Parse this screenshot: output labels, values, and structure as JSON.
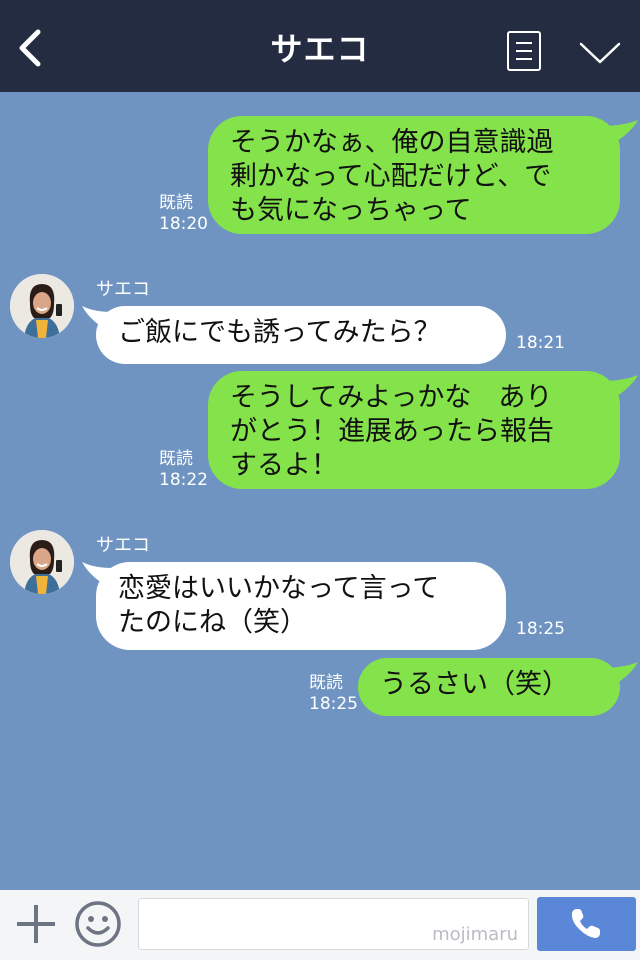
{
  "header": {
    "title": "サエコ",
    "back_icon": "chevron-left-icon",
    "menu_icon": "menu-list-icon",
    "more_icon": "chevron-down-icon"
  },
  "messages": [
    {
      "from": "me",
      "lines": [
        "そうかなぁ、俺の自意識過",
        "剰かなって心配だけど、で",
        "も気になっちゃって"
      ],
      "read": "既読",
      "time": "18:20"
    },
    {
      "from": "them",
      "name": "サエコ",
      "lines": [
        "ご飯にでも誘ってみたら？"
      ],
      "time": "18:21"
    },
    {
      "from": "me",
      "lines": [
        "そうしてみよっかな　あり",
        "がとう！進展あったら報告",
        "するよ！"
      ],
      "read": "既読",
      "time": "18:22"
    },
    {
      "from": "them",
      "name": "サエコ",
      "lines": [
        "恋愛はいいかなって言って",
        "たのにね（笑）"
      ],
      "time": "18:25"
    },
    {
      "from": "me",
      "lines": [
        "うるさい（笑）"
      ],
      "read": "既読",
      "time": "18:25"
    }
  ],
  "footer": {
    "input_placeholder": "",
    "watermark": "mojimaru",
    "plus_icon": "plus-icon",
    "emoji_icon": "smile-icon",
    "call_icon": "phone-icon"
  },
  "colors": {
    "header": "#232c41",
    "background": "#7094c2",
    "my_bubble": "#84e34a",
    "their_bubble": "#ffffff",
    "call_button": "#5b87d8"
  }
}
